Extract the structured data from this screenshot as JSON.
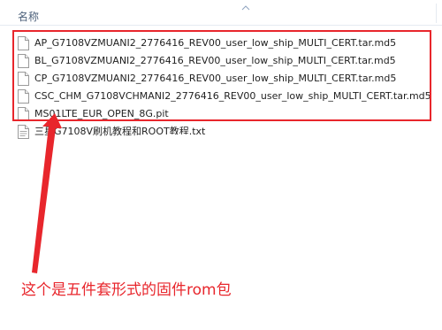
{
  "header": {
    "name_column": "名称"
  },
  "files": [
    {
      "name": "AP_G7108VZMUANI2_2776416_REV00_user_low_ship_MULTI_CERT.tar.md5",
      "icon": "document-icon"
    },
    {
      "name": "BL_G7108VZMUANI2_2776416_REV00_user_low_ship_MULTI_CERT.tar.md5",
      "icon": "document-icon"
    },
    {
      "name": "CP_G7108VZMUANI2_2776416_REV00_user_low_ship_MULTI_CERT.tar.md5",
      "icon": "document-icon"
    },
    {
      "name": "CSC_CHM_G7108VCHMANI2_2776416_REV00_user_low_ship_MULTI_CERT.tar.md5",
      "icon": "document-icon"
    },
    {
      "name": "MS01LTE_EUR_OPEN_8G.pit",
      "icon": "document-icon"
    },
    {
      "name": "三星G7108V刷机教程和ROOT教程.txt",
      "icon": "text-file-icon"
    }
  ],
  "annotation": {
    "caption": "这个是五件套形式的固件rom包",
    "color": "#e8262c"
  }
}
